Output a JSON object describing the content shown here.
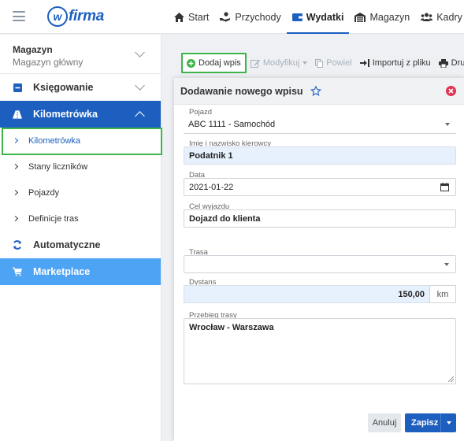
{
  "app": {
    "logo_text": "firma",
    "logo_letter": "w",
    "brand_color": "#1d5fbf",
    "nav": [
      {
        "label": "Start",
        "icon": "home-icon"
      },
      {
        "label": "Przychody",
        "icon": "hand-coin-icon"
      },
      {
        "label": "Wydatki",
        "icon": "wallet-icon",
        "active": true
      },
      {
        "label": "Magazyn",
        "icon": "warehouse-icon"
      },
      {
        "label": "Kadry",
        "icon": "users-icon"
      }
    ]
  },
  "sidebar": {
    "warehouse_title": "Magazyn",
    "warehouse_sub": "Magazyn główny",
    "sections": {
      "accounting": "Księgowanie",
      "mileage": "Kilometrówka",
      "automatic": "Automatyczne",
      "marketplace": "Marketplace"
    },
    "sub_items": [
      "Kilometrówka",
      "Stany liczników",
      "Pojazdy",
      "Definicje tras"
    ],
    "active_sub": "Kilometrówka",
    "accent_color": "#1d5fbf",
    "marketplace_color": "#4da3f4",
    "highlight_color": "#3cb54a"
  },
  "toolbar": {
    "add": "Dodaj wpis",
    "modify": "Modyfikuj",
    "repeat": "Powiel",
    "import": "Importuj z pliku",
    "print": "Drukuj"
  },
  "modal": {
    "title": "Dodawanie nowego wpisu",
    "fields": {
      "vehicle_label": "Pojazd",
      "vehicle_value": "ABC 1111 - Samochód",
      "driver_label": "Imię i nazwisko kierowcy",
      "driver_value": "Podatnik 1",
      "date_label": "Data",
      "date_value": "2021-01-22",
      "purpose_label": "Cel wyjazdu",
      "purpose_value": "Dojazd do klienta",
      "route_label": "Trasa",
      "route_value": "",
      "distance_label": "Dystans",
      "distance_value": "150,00",
      "distance_unit": "km",
      "course_label": "Przebieg trasy",
      "course_value": "Wrocław - Warszawa"
    },
    "cancel": "Anuluj",
    "save": "Zapisz"
  }
}
